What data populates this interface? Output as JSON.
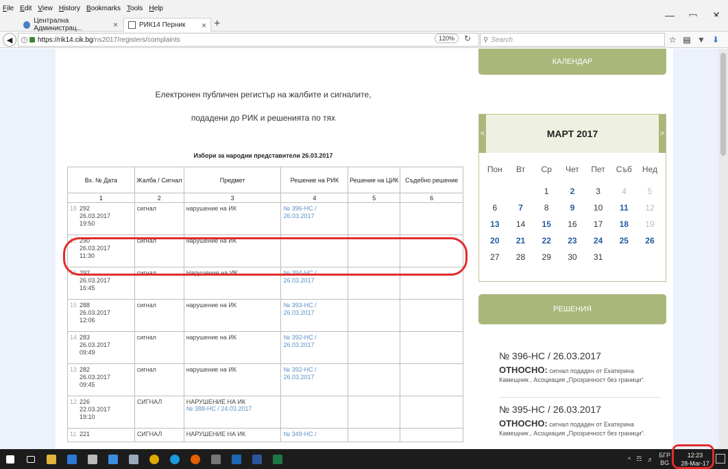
{
  "menu": [
    "File",
    "Edit",
    "View",
    "History",
    "Bookmarks",
    "Tools",
    "Help"
  ],
  "tabs": [
    {
      "label": "Централна Администрац..."
    },
    {
      "label": "РИК14 Перник"
    }
  ],
  "url": {
    "host": "https://rik14.cik.bg",
    "path": "/ns2017/registers/complaints"
  },
  "zoom": "120%",
  "search_placeholder": "Search",
  "page": {
    "heading1": "Електронен публичен регистър на жалбите и сигналите,",
    "heading2": "подадени до РИК и решенията по тях",
    "election": "Избори за народни представители 26.03.2017",
    "columns": [
      "Вх. № Дата",
      "Жалба / Сигнал",
      "Предмет",
      "Решение на РИК",
      "Решение на ЦИК",
      "Съдебно решение"
    ],
    "column_numbers": [
      "1",
      "2",
      "3",
      "4",
      "5",
      "6"
    ],
    "rows": [
      {
        "idx": "18",
        "num": "292",
        "date": "26.03.2017",
        "time": "19:50",
        "type": "сигнал",
        "subject": "нарушение на ИК",
        "subject_link": "",
        "rik1": "№ 396-НС /",
        "rik2": "26.03.2017"
      },
      {
        "idx": "17",
        "num": "290",
        "date": "26.03.2017",
        "time": "11:30",
        "type": "сигнал",
        "subject": "нарушение на ИК",
        "subject_link": "",
        "rik1": "",
        "rik2": ""
      },
      {
        "idx": "16",
        "num": "292",
        "date": "26.03.2017",
        "time": "16:45",
        "type": "сигнал",
        "subject": "Нарушение на ИК",
        "subject_link": "",
        "rik1": "№ 394-НС /",
        "rik2": "26.03.2017"
      },
      {
        "idx": "15",
        "num": "288",
        "date": "26.03.2017",
        "time": "12:06",
        "type": "сигнал",
        "subject": "нарушение на ИК",
        "subject_link": "",
        "rik1": "№ 393-НС /",
        "rik2": "26.03.2017"
      },
      {
        "idx": "14",
        "num": "283",
        "date": "26.03.2017",
        "time": "09:49",
        "type": "сигнал",
        "subject": "нарушение на ИК",
        "subject_link": "",
        "rik1": "№ 392-НС /",
        "rik2": "26.03.2017"
      },
      {
        "idx": "13",
        "num": "282",
        "date": "26.03.2017",
        "time": "09:45",
        "type": "сигнал",
        "subject": "нарушение на ИК",
        "subject_link": "",
        "rik1": "№ 392-НС /",
        "rik2": "26.03.2017"
      },
      {
        "idx": "12",
        "num": "226",
        "date": "22.03.2017",
        "time": "19:10",
        "type": "СИГНАЛ",
        "subject": "НАРУШЕНИЕ НА ИК",
        "subject_link": "№ 388-НС / 24.03.2017",
        "rik1": "",
        "rik2": ""
      },
      {
        "idx": "11",
        "num": "221",
        "date": "",
        "time": "",
        "type": "СИГНАЛ",
        "subject": "НАРУШЕНИЕ НА ИК",
        "subject_link": "",
        "rik1": "№ 349-НС /",
        "rik2": ""
      }
    ]
  },
  "sidebar": {
    "calendar_label": "КАЛЕНДАР",
    "month": "МАРТ 2017",
    "prev": "<",
    "next": ">",
    "weekdays": [
      "Пон",
      "Вт",
      "Ср",
      "Чет",
      "Пет",
      "Съб",
      "Нед"
    ],
    "weeks": [
      [
        {
          "d": "",
          "s": ""
        },
        {
          "d": "",
          "s": ""
        },
        {
          "d": "1",
          "s": ""
        },
        {
          "d": "2",
          "s": "l"
        },
        {
          "d": "3",
          "s": ""
        },
        {
          "d": "4",
          "s": "m"
        },
        {
          "d": "5",
          "s": "m"
        }
      ],
      [
        {
          "d": "6",
          "s": ""
        },
        {
          "d": "7",
          "s": "l"
        },
        {
          "d": "8",
          "s": ""
        },
        {
          "d": "9",
          "s": "l"
        },
        {
          "d": "10",
          "s": ""
        },
        {
          "d": "11",
          "s": "l"
        },
        {
          "d": "12",
          "s": "m"
        }
      ],
      [
        {
          "d": "13",
          "s": "l"
        },
        {
          "d": "14",
          "s": ""
        },
        {
          "d": "15",
          "s": "l"
        },
        {
          "d": "16",
          "s": ""
        },
        {
          "d": "17",
          "s": ""
        },
        {
          "d": "18",
          "s": "l"
        },
        {
          "d": "19",
          "s": "m"
        }
      ],
      [
        {
          "d": "20",
          "s": "l"
        },
        {
          "d": "21",
          "s": "l"
        },
        {
          "d": "22",
          "s": "l"
        },
        {
          "d": "23",
          "s": "l"
        },
        {
          "d": "24",
          "s": "l"
        },
        {
          "d": "25",
          "s": "l"
        },
        {
          "d": "26",
          "s": "l"
        }
      ],
      [
        {
          "d": "27",
          "s": ""
        },
        {
          "d": "28",
          "s": ""
        },
        {
          "d": "29",
          "s": ""
        },
        {
          "d": "30",
          "s": ""
        },
        {
          "d": "31",
          "s": ""
        },
        {
          "d": "",
          "s": ""
        },
        {
          "d": "",
          "s": ""
        }
      ]
    ],
    "decisions_label": "РЕШЕНИЯ",
    "decisions": [
      {
        "title": "№ 396-НС / 26.03.2017",
        "re": "ОТНОСНО:",
        "text": "сигнал подаден от Екатерина Камещник , Асоциация „Прозрачност без граници“."
      },
      {
        "title": "№ 395-НС / 26.03.2017",
        "re": "ОТНОСНО:",
        "text": "сигнал подаден от Екатерина Камещник , Асоциация „Прозрачност без граници“."
      }
    ]
  },
  "taskbar": {
    "lang1": "БГР",
    "lang2": "BG",
    "time": "12:23",
    "date": "28-Mar-17"
  },
  "colors": {
    "accent": "#a9b77a",
    "link": "#1f5b9e",
    "highlight": "#e32b2b"
  }
}
